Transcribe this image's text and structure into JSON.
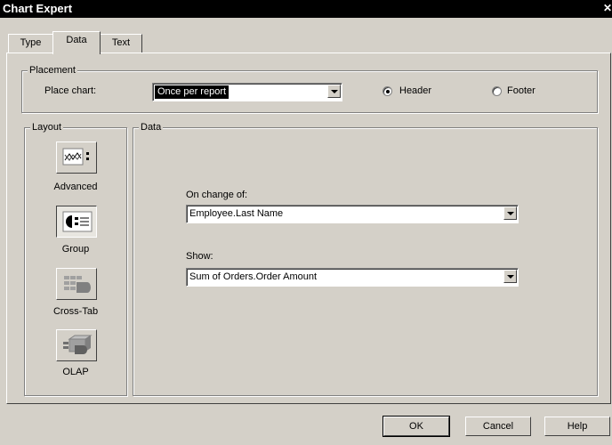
{
  "window": {
    "title": "Chart Expert",
    "close_glyph": "✕"
  },
  "tabs": [
    {
      "label": "Type",
      "active": false
    },
    {
      "label": "Data",
      "active": true
    },
    {
      "label": "Text",
      "active": false
    }
  ],
  "placement": {
    "group_label": "Placement",
    "place_chart_label": "Place chart:",
    "place_chart_value": "Once per report",
    "radio_header": "Header",
    "radio_footer": "Footer",
    "selected_radio": "Header"
  },
  "layout": {
    "group_label": "Layout",
    "buttons": [
      {
        "label": "Advanced",
        "icon": "advanced-chart-icon",
        "pressed": false
      },
      {
        "label": "Group",
        "icon": "group-chart-icon",
        "pressed": true
      },
      {
        "label": "Cross-Tab",
        "icon": "cross-tab-icon",
        "pressed": false
      },
      {
        "label": "OLAP",
        "icon": "olap-cube-icon",
        "pressed": false
      }
    ]
  },
  "data": {
    "group_label": "Data",
    "on_change_label": "On change of:",
    "on_change_value": "Employee.Last Name",
    "show_label": "Show:",
    "show_value": "Sum of Orders.Order Amount"
  },
  "footer_buttons": {
    "ok": "OK",
    "cancel": "Cancel",
    "help": "Help"
  }
}
